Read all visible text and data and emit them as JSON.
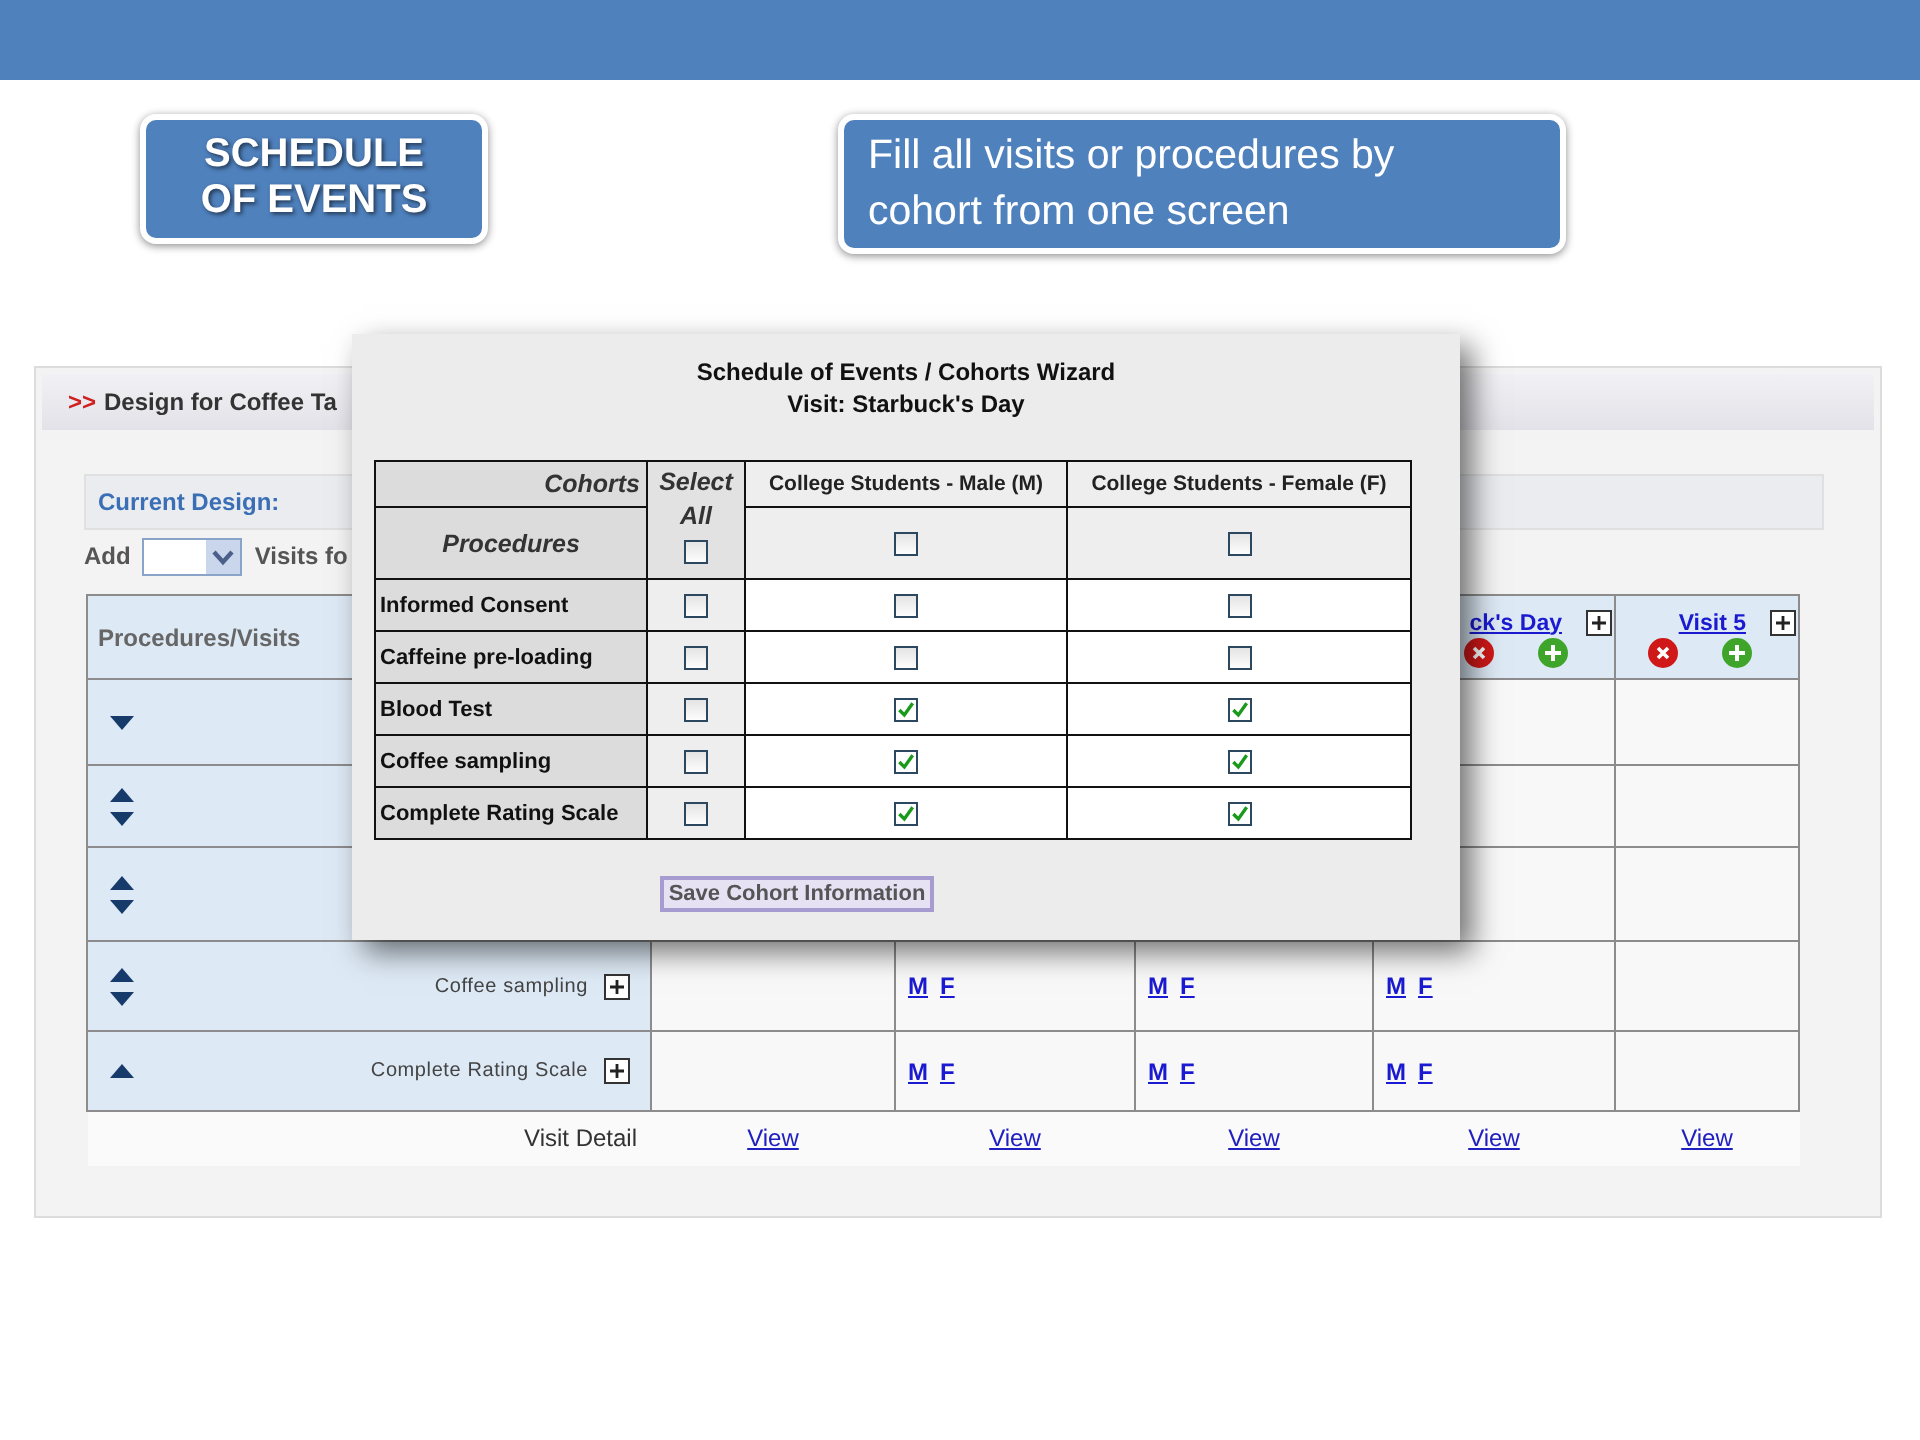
{
  "slide": {
    "badge": "SCHEDULE OF EVENTS",
    "callout": "Fill all visits or procedures by cohort from one screen"
  },
  "design_panel": {
    "marker": ">>",
    "title": "Design for Coffee Ta",
    "current_design_label": "Current Design:",
    "add_label": "Add",
    "visits_label": "Visits fo"
  },
  "schedule_table": {
    "header": "Procedures/Visits",
    "visits": [
      {
        "view": "View"
      },
      {
        "view": "View"
      },
      {
        "view": "View"
      },
      {
        "label": "ck's Day",
        "view": "View"
      },
      {
        "label": "Visit 5",
        "view": "View"
      }
    ],
    "rows": [
      {
        "kind": "down"
      },
      {
        "kind": "both"
      },
      {
        "kind": "both"
      },
      {
        "kind": "both",
        "name": "Coffee sampling",
        "cells": [
          {
            "kind": "empty"
          },
          {
            "kind": "links",
            "links": [
              "M",
              "F"
            ]
          },
          {
            "kind": "links",
            "links": [
              "M",
              "F"
            ]
          },
          {
            "kind": "links",
            "links": [
              "M",
              "F"
            ]
          },
          {
            "kind": "empty"
          }
        ]
      },
      {
        "kind": "up",
        "name": "Complete Rating Scale",
        "cells": [
          {
            "kind": "empty"
          },
          {
            "kind": "links",
            "links": [
              "M",
              "F"
            ]
          },
          {
            "kind": "links",
            "links": [
              "M",
              "F"
            ]
          },
          {
            "kind": "links",
            "links": [
              "M",
              "F"
            ]
          },
          {
            "kind": "empty"
          }
        ]
      }
    ],
    "footer_label": "Visit Detail"
  },
  "wizard": {
    "title": "Schedule of Events / Cohorts Wizard",
    "subtitle": "Visit: Starbuck's Day",
    "cohorts_label": "Cohorts",
    "procedures_label": "Procedures",
    "select_all_label": "Select All",
    "select_all_checked": false,
    "cohorts": [
      {
        "name": "College Students - Male (M)",
        "checked": false
      },
      {
        "name": "College Students - Female (F)",
        "checked": false
      }
    ],
    "procedures": [
      {
        "name": "Informed Consent",
        "select_all": false,
        "cohorts": [
          {
            "checked": false
          },
          {
            "checked": false
          }
        ]
      },
      {
        "name": "Caffeine pre-loading",
        "select_all": false,
        "cohorts": [
          {
            "checked": false
          },
          {
            "checked": false
          }
        ]
      },
      {
        "name": "Blood Test",
        "select_all": false,
        "cohorts": [
          {
            "checked": true
          },
          {
            "checked": true
          }
        ]
      },
      {
        "name": "Coffee sampling",
        "select_all": false,
        "cohorts": [
          {
            "checked": true
          },
          {
            "checked": true
          }
        ]
      },
      {
        "name": "Complete Rating Scale",
        "select_all": false,
        "cohorts": [
          {
            "checked": true
          },
          {
            "checked": true
          }
        ]
      }
    ],
    "save_button": "Save Cohort Information"
  }
}
